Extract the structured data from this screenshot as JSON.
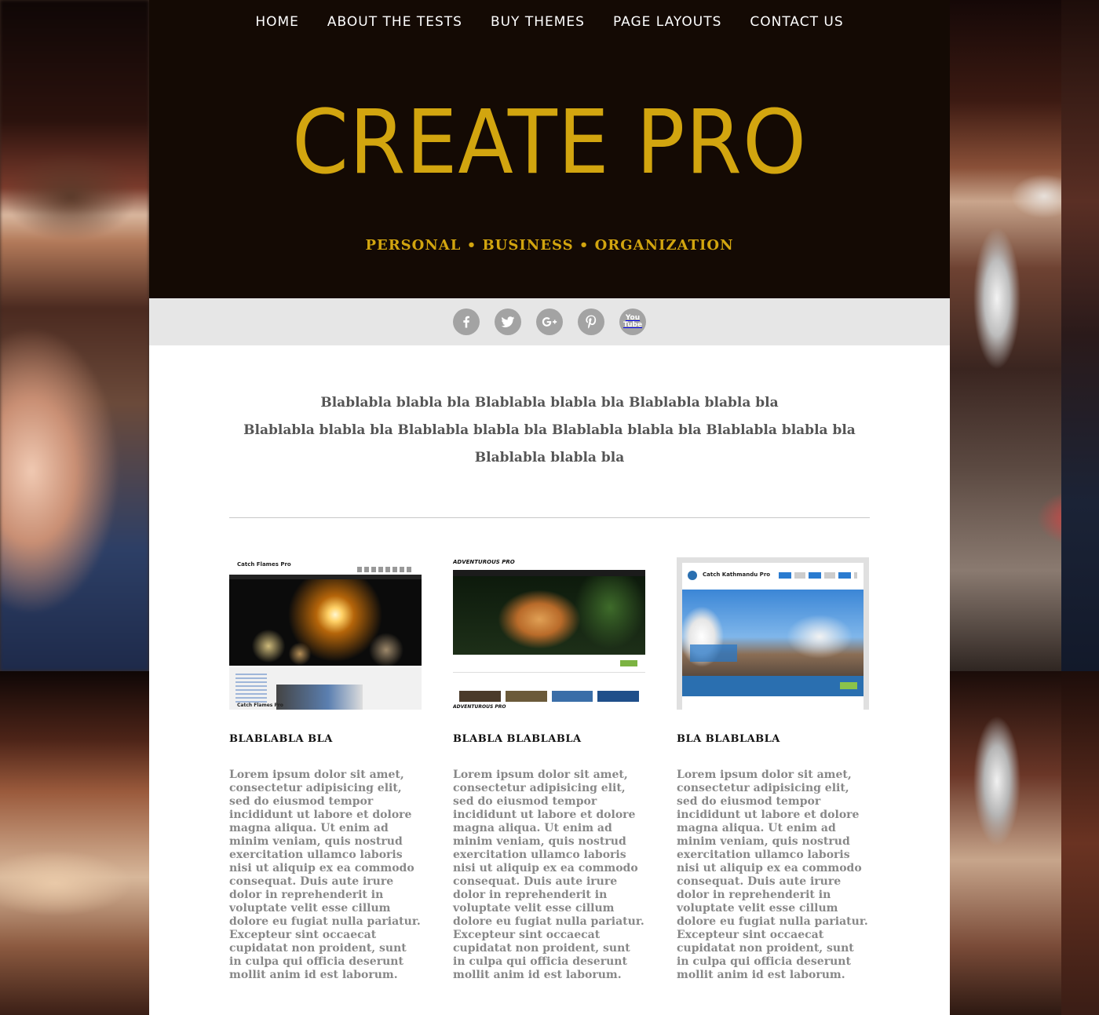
{
  "nav": {
    "items": [
      "HOME",
      "ABOUT THE TESTS",
      "BUY THEMES",
      "PAGE LAYOUTS",
      "CONTACT US"
    ]
  },
  "header": {
    "site_title": "CREATE PRO",
    "tagline": "PERSONAL • BUSINESS • ORGANIZATION",
    "background_color": "#140a04",
    "title_color": "#d2a50f"
  },
  "social": {
    "icons": [
      "facebook-icon",
      "twitter-icon",
      "google-plus-icon",
      "pinterest-icon",
      "youtube-icon"
    ],
    "youtube_text": [
      "You",
      "Tube"
    ],
    "icon_color": "#a3a3a3",
    "bar_color": "#e6e6e6"
  },
  "intro": {
    "lines": [
      "Blablabla blabla bla Blablabla blabla bla Blablabla blabla bla",
      "Blablabla blabla bla Blablabla blabla bla Blablabla blabla bla Blablabla blabla bla",
      "Blablabla blabla bla"
    ]
  },
  "features": [
    {
      "title": "BLABLABLA BLA",
      "thumb_title": "Catch Flames Pro",
      "thumb_footer": "Catch Flames Pro",
      "body": "Lorem ipsum dolor sit amet, consectetur adipisicing elit, sed do eiusmod tempor incididunt ut labore et dolore magna aliqua. Ut enim ad minim veniam, quis nostrud exercitation ullamco laboris nisi ut aliquip ex ea commodo consequat. Duis aute irure dolor in reprehenderit in voluptate velit esse cillum dolore eu fugiat nulla pariatur. Excepteur sint occaecat cupidatat non proident, sunt in culpa qui officia deserunt mollit anim id est laborum."
    },
    {
      "title": "BLABLA BLABLABLA",
      "thumb_title": "ADVENTUROUS PRO",
      "thumb_footer": "ADVENTUROUS PRO",
      "body": "Lorem ipsum dolor sit amet, consectetur adipisicing elit, sed do eiusmod tempor incididunt ut labore et dolore magna aliqua. Ut enim ad minim veniam, quis nostrud exercitation ullamco laboris nisi ut aliquip ex ea commodo consequat. Duis aute irure dolor in reprehenderit in voluptate velit esse cillum dolore eu fugiat nulla pariatur. Excepteur sint occaecat cupidatat non proident, sunt in culpa qui officia deserunt mollit anim id est laborum."
    },
    {
      "title": "BLA BLABLABLA",
      "thumb_title": "Catch Kathmandu Pro",
      "body": "Lorem ipsum dolor sit amet, consectetur adipisicing elit, sed do eiusmod tempor incididunt ut labore et dolore magna aliqua. Ut enim ad minim veniam, quis nostrud exercitation ullamco laboris nisi ut aliquip ex ea commodo consequat. Duis aute irure dolor in reprehenderit in voluptate velit esse cillum dolore eu fugiat nulla pariatur. Excepteur sint occaecat cupidatat non proident, sunt in culpa qui officia deserunt mollit anim id est laborum."
    }
  ]
}
